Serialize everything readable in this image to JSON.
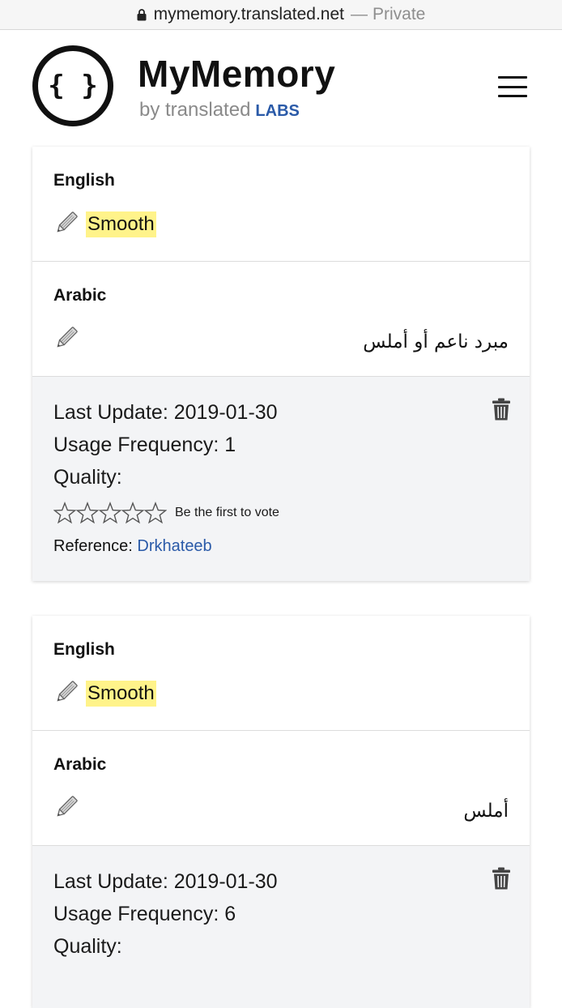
{
  "browser": {
    "url": "mymemory.translated.net",
    "separator": "—",
    "mode": "Private"
  },
  "header": {
    "logo_glyph": "{ }",
    "title": "MyMemory",
    "subtitle": "by translated",
    "labs": "LABS",
    "menu_icon": "hamburger-menu-icon"
  },
  "results": [
    {
      "source_lang": "English",
      "source_text": "Smooth",
      "target_lang": "Arabic",
      "target_text": "مبرد ناعم أو أملس",
      "last_update": "Last Update: 2019-01-30",
      "usage": "Usage Frequency: 1",
      "quality": "Quality:",
      "vote_text": "Be the first to vote",
      "reference_label": "Reference:",
      "reference_value": "Drkhateeb"
    },
    {
      "source_lang": "English",
      "source_text": "Smooth",
      "target_lang": "Arabic",
      "target_text": "أملس",
      "last_update": "Last Update: 2019-01-30",
      "usage": "Usage Frequency: 6",
      "quality": "Quality:"
    }
  ],
  "colors": {
    "highlight": "#fff38a",
    "link": "#2a5aa8",
    "meta_bg": "#f3f4f6"
  }
}
